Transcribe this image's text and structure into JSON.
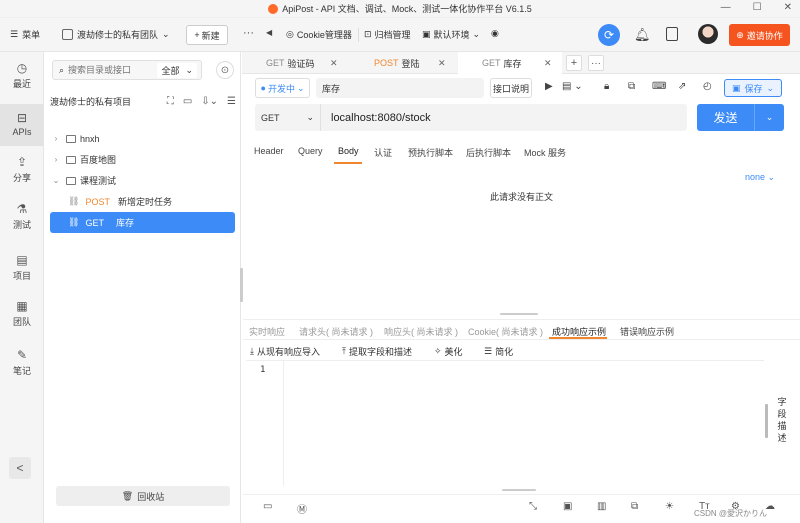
{
  "window": {
    "title": "ApiPost - API 文档、调试、Mock、测试一体化协作平台 V6.1.5",
    "controls": [
      "—",
      "☐",
      "✕"
    ]
  },
  "topbar": {
    "menu_label": "菜单",
    "team_name": "渡劫修士的私有团队",
    "new_label": "新建",
    "more": "···",
    "back_arrow": "◀",
    "cookie_label": "Cookie管理器",
    "archive_label": "归档管理",
    "env_label": "默认环境",
    "invite_label": "邀请协作"
  },
  "rail": {
    "items": [
      {
        "label": "最近",
        "icon": "clock-icon",
        "glyph": "◷"
      },
      {
        "label": "APIs",
        "icon": "api-icon",
        "glyph": "⊟"
      },
      {
        "label": "分享",
        "icon": "share-icon",
        "glyph": "⇪"
      },
      {
        "label": "测试",
        "icon": "test-icon",
        "glyph": "⚗"
      },
      {
        "label": "项目",
        "icon": "project-icon",
        "glyph": "▤"
      },
      {
        "label": "团队",
        "icon": "team-icon",
        "glyph": "▦"
      },
      {
        "label": "笔记",
        "icon": "notes-icon",
        "glyph": "✎"
      }
    ],
    "collapse": "<"
  },
  "sidebar": {
    "search_placeholder": "搜索目录或接口",
    "scope": "全部",
    "project_title": "渡劫修士的私有项目",
    "tree": [
      {
        "type": "folder",
        "label": "hnxh"
      },
      {
        "type": "folder",
        "label": "百度地图"
      },
      {
        "type": "folder-open",
        "label": "课程测试"
      },
      {
        "type": "api",
        "method": "POST",
        "label": "新增定时任务"
      },
      {
        "type": "api",
        "method": "GET",
        "label": "库存",
        "selected": true
      }
    ],
    "recycle_label": "回收站"
  },
  "tabs": [
    {
      "method": "GET",
      "label": "验证码"
    },
    {
      "method": "POST",
      "label": "登陆"
    },
    {
      "method": "GET",
      "label": "库存",
      "active": true
    }
  ],
  "request": {
    "env": "开发中",
    "name": "库存",
    "doc_label": "接口说明",
    "save_label": "保存",
    "method": "GET",
    "url": "localhost:8080/stock",
    "send_label": "发送",
    "tabs": [
      "Header",
      "Query",
      "Body",
      "认证",
      "预执行脚本",
      "后执行脚本",
      "Mock 服务"
    ],
    "active_tab": "Body",
    "body_mode": "none",
    "empty_body_text": "此请求没有正文"
  },
  "response": {
    "tabs": [
      "实时响应",
      "请求头( 尚未请求 )",
      "响应头( 尚未请求 )",
      "Cookie( 尚未请求 )",
      "成功响应示例",
      "错误响应示例"
    ],
    "active_tab": "成功响应示例",
    "actions": [
      "从现有响应导入",
      "提取字段和描述",
      "美化",
      "简化"
    ],
    "line_number": "1",
    "field_desc_label": "字段描述"
  },
  "watermark": "CSDN @愛沢かりん",
  "colors": {
    "accent": "#3c8bf7",
    "brand": "#f5541f",
    "post": "#f0872f"
  }
}
